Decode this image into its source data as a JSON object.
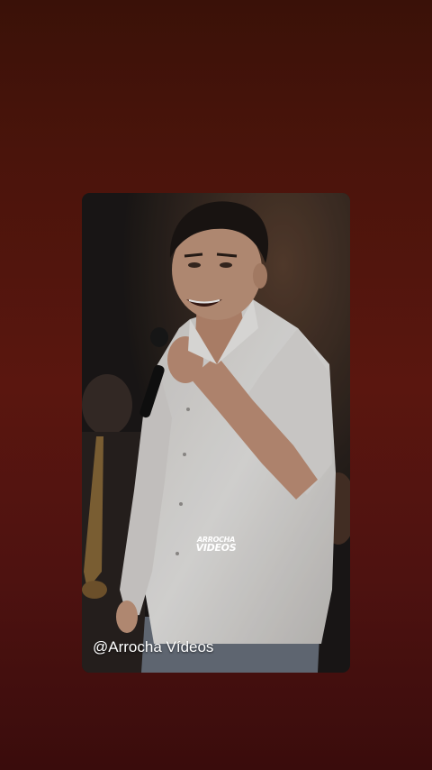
{
  "story": {
    "watermark_line1": "ARROCHA",
    "watermark_line2": "VIDEOS",
    "handle": "@Arrocha Vídeos"
  },
  "colors": {
    "background_top": "#3a1108",
    "background_bottom": "#3a0c0c",
    "shirt": "#e8e6e4",
    "text": "#ffffff"
  }
}
